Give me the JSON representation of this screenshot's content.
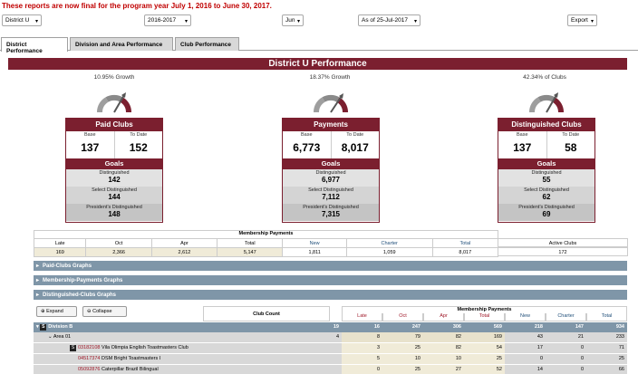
{
  "notice": "These reports are now final for the program year July 1, 2016 to June 30, 2017.",
  "filters": {
    "district": "District U",
    "year": "2016-2017",
    "month": "Jun",
    "asof": "As of 25-Jul-2017",
    "export": "Export"
  },
  "tabs": [
    "District Performance",
    "Division and Area Performance",
    "Club Performance"
  ],
  "banner": "District U Performance",
  "growth": [
    "10.95% Growth",
    "18.37% Growth",
    "42.34% of Clubs"
  ],
  "cards": [
    {
      "title": "Paid Clubs",
      "base_label": "Base",
      "todate_label": "To Date",
      "base": "137",
      "todate": "152",
      "goals_title": "Goals",
      "goals": [
        {
          "label": "Distinguished",
          "value": "142"
        },
        {
          "label": "Select Distinguished",
          "value": "144"
        },
        {
          "label": "President's Distinguished",
          "value": "148"
        }
      ]
    },
    {
      "title": "Payments",
      "base_label": "Base",
      "todate_label": "To Date",
      "base": "6,773",
      "todate": "8,017",
      "goals_title": "Goals",
      "goals": [
        {
          "label": "Distinguished",
          "value": "6,977"
        },
        {
          "label": "Select Distinguished",
          "value": "7,112"
        },
        {
          "label": "President's Distinguished",
          "value": "7,315"
        }
      ]
    },
    {
      "title": "Distinguished Clubs",
      "base_label": "Base",
      "todate_label": "To Date",
      "base": "137",
      "todate": "58",
      "goals_title": "Goals",
      "goals": [
        {
          "label": "Distinguished",
          "value": "55"
        },
        {
          "label": "Select Distinguished",
          "value": "62"
        },
        {
          "label": "President's Distinguished",
          "value": "69"
        }
      ]
    }
  ],
  "membership": {
    "title": "Membership Payments",
    "headers": [
      "Late",
      "Oct",
      "Apr",
      "Total",
      "New",
      "Charter",
      "Total"
    ],
    "values": [
      "169",
      "2,366",
      "2,612",
      "5,147",
      "1,811",
      "1,059",
      "8,017"
    ]
  },
  "active_clubs": {
    "label": "Active Clubs",
    "value": "172"
  },
  "sections": [
    "Paid-Clubs Graphs",
    "Membership-Payments Graphs",
    "Distinguished-Clubs Graphs"
  ],
  "buttons": {
    "expand": "Expand",
    "collapse": "Collapse"
  },
  "club_count": "Club Count",
  "grid": {
    "title": "Membership Payments",
    "headers": [
      "Late",
      "Oct",
      "Apr",
      "Total",
      "New",
      "Charter",
      "Total"
    ],
    "division": {
      "name": "Division B",
      "values": [
        "19",
        "16",
        "247",
        "306",
        "569",
        "218",
        "147",
        "934"
      ]
    },
    "area": {
      "name": "Area 01",
      "values": [
        "4",
        "8",
        "79",
        "82",
        "169",
        "43",
        "21",
        "233"
      ]
    },
    "clubs": [
      {
        "id": "03182108",
        "name": "Vila Olimpia English Toastmasters Club",
        "values": [
          "3",
          "25",
          "82",
          "54",
          "17",
          "0",
          "71"
        ]
      },
      {
        "id": "04517374",
        "name": "DSM Bright Toastmasters I",
        "values": [
          "5",
          "10",
          "10",
          "25",
          "0",
          "0",
          "25"
        ]
      },
      {
        "id": "05092876",
        "name": "Caterpillar Brazil Bilingual",
        "values": [
          "0",
          "25",
          "27",
          "52",
          "14",
          "0",
          "66"
        ]
      }
    ]
  },
  "colors": {
    "brand": "#7b1f2f",
    "bar": "#7f96a8",
    "highlight": "#f0ebd8"
  }
}
